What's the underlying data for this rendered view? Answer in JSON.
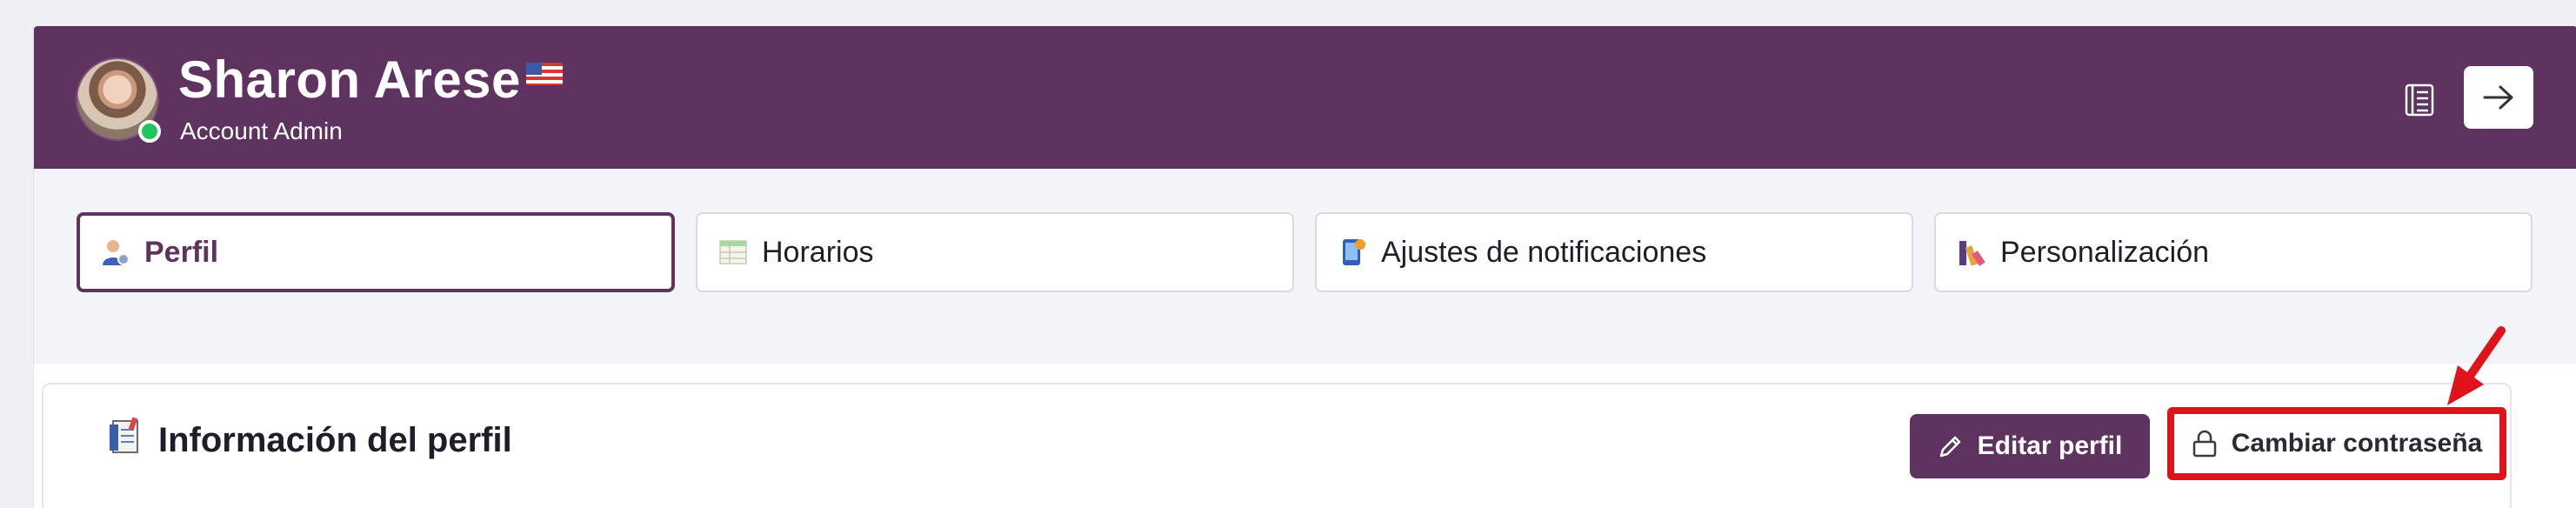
{
  "header": {
    "user_name": "Sharon Arese",
    "role": "Account Admin",
    "flag_icon": "us-flag-icon",
    "notes_icon": "notes-icon",
    "exit_icon": "arrow-right-icon",
    "colors": {
      "brand": "#5e3360",
      "status_online": "#22c55e"
    }
  },
  "tabs": [
    {
      "label": "Perfil",
      "icon": "user-settings-icon",
      "active": true
    },
    {
      "label": "Horarios",
      "icon": "schedule-table-icon",
      "active": false
    },
    {
      "label": "Ajustes de notificaciones",
      "icon": "phone-notification-icon",
      "active": false
    },
    {
      "label": "Personalización",
      "icon": "palette-icon",
      "active": false
    }
  ],
  "profile_card": {
    "title": "Información del perfil",
    "title_icon": "clipboard-icon",
    "edit_button": "Editar perfil",
    "edit_icon": "pencil-icon",
    "password_button": "Cambiar contraseña",
    "password_icon": "lock-icon",
    "highlight_color": "#e0131b"
  }
}
